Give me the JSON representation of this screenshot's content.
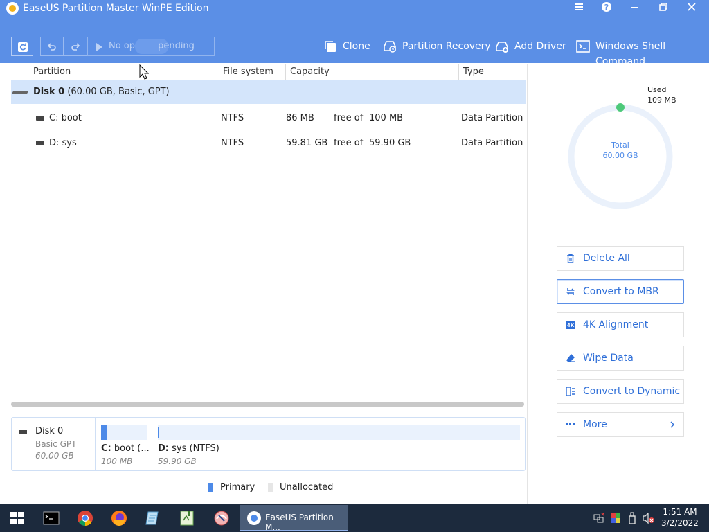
{
  "window": {
    "title": "EaseUS Partition Master WinPE Edition",
    "controls": [
      "menu-icon",
      "help-icon",
      "minimize-icon",
      "restore-icon",
      "close-icon"
    ]
  },
  "toolbar": {
    "pending_label": "No op        pending",
    "actions": [
      {
        "label": "Clone",
        "icon": "clone-icon"
      },
      {
        "label": "Partition Recovery",
        "icon": "partition-recovery-icon"
      },
      {
        "label": "Add Driver",
        "icon": "add-driver-icon"
      },
      {
        "label": "Windows Shell Command",
        "icon": "shell-command-icon"
      }
    ]
  },
  "grid": {
    "columns": [
      "Partition",
      "File system",
      "Capacity",
      "Type"
    ],
    "disk": {
      "name": "Disk 0",
      "detail": "(60.00 GB, Basic, GPT)"
    },
    "partitions": [
      {
        "name": "C: boot",
        "fs": "NTFS",
        "free": "86 MB",
        "free_of": "free of",
        "total": "100 MB",
        "type": "Data Partition"
      },
      {
        "name": "D: sys",
        "fs": "NTFS",
        "free": "59.81 GB",
        "free_of": "free of",
        "total": "59.90 GB",
        "type": "Data Partition"
      }
    ]
  },
  "diskmap": {
    "disk_name": "Disk 0",
    "disk_type": "Basic GPT",
    "disk_size": "60.00 GB",
    "segments": [
      {
        "label_bold": "C:",
        "label_rest": " boot (...",
        "size": "100 MB",
        "used_fraction": 0.14
      },
      {
        "label_bold": "D:",
        "label_rest": " sys (NTFS)",
        "size": "59.90 GB",
        "used_fraction": 0.0015
      }
    ]
  },
  "legend": [
    {
      "label": "Primary",
      "color": "#4d8ae8"
    },
    {
      "label": "Unallocated",
      "color": "#e6e6e6"
    }
  ],
  "donut": {
    "used_label": "Used",
    "used_value": "109 MB",
    "total_label": "Total",
    "total_value": "60.00 GB",
    "used_fraction": 0.0018
  },
  "side_actions": [
    {
      "label": "Delete All",
      "icon": "trash-icon"
    },
    {
      "label": "Convert to MBR",
      "icon": "convert-icon"
    },
    {
      "label": "4K Alignment",
      "icon": "alignment-4k-icon"
    },
    {
      "label": "Wipe Data",
      "icon": "eraser-icon"
    },
    {
      "label": "Convert to Dynamic",
      "icon": "dynamic-disk-icon"
    },
    {
      "label": "More",
      "icon": "more-dots-icon"
    }
  ],
  "taskbar": {
    "active_app": "EaseUS Partition M...",
    "time": "1:51 AM",
    "date": "3/2/2022"
  },
  "colors": {
    "header": "#5b8fe6",
    "accent": "#2f6fd8",
    "selection": "#d4e5fb"
  }
}
